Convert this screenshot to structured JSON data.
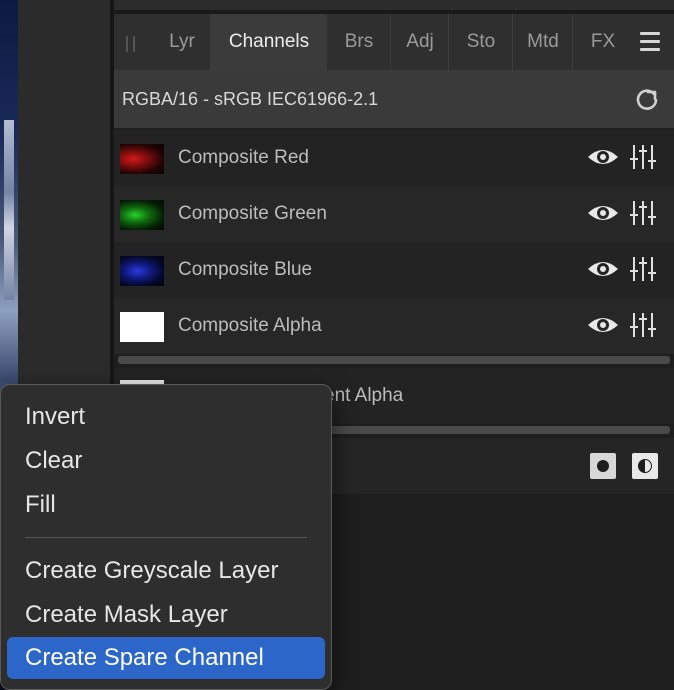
{
  "tabs": [
    {
      "label": "Lyr",
      "active": false
    },
    {
      "label": "Channels",
      "active": true
    },
    {
      "label": "Brs",
      "active": false
    },
    {
      "label": "Adj",
      "active": false
    },
    {
      "label": "Sto",
      "active": false
    },
    {
      "label": "Mtd",
      "active": false
    },
    {
      "label": "FX",
      "active": false
    }
  ],
  "profile": {
    "label": "RGBA/16 - sRGB IEC61966-2.1"
  },
  "channels": [
    {
      "label": "Composite Red"
    },
    {
      "label": "Composite Green"
    },
    {
      "label": "Composite Blue"
    },
    {
      "label": "Composite Alpha"
    }
  ],
  "secondary": {
    "label": "ent Alpha"
  },
  "context_menu": {
    "items": [
      "Invert",
      "Clear",
      "Fill"
    ],
    "items2": [
      "Create Greyscale Layer",
      "Create Mask Layer"
    ],
    "selected": "Create Spare Channel"
  },
  "colors": {
    "accent": "#2b66c8",
    "panel_bg": "#1e1e1e",
    "tab_active": "#3b3b3b"
  }
}
